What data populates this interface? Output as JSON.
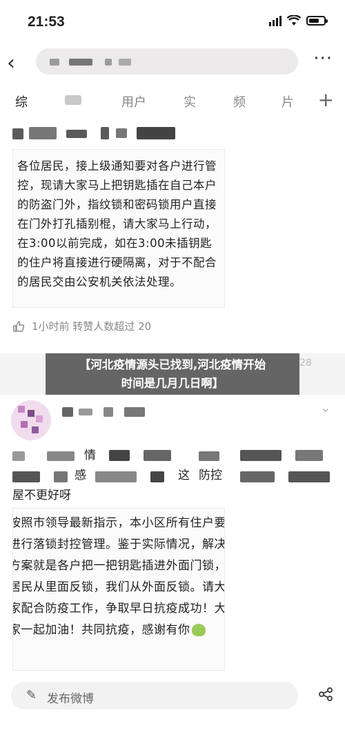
{
  "status": {
    "time": "21:53"
  },
  "nav": {
    "back_icon": "‹",
    "more_icon": "···"
  },
  "tabs": {
    "items": [
      "综",
      "用户",
      "实",
      "频",
      "片"
    ],
    "plus": "+"
  },
  "post1": {
    "notice_text": "各位居民，接上级通知要对各户进行管控，现请大家马上把钥匙插在自己本户的防盗门外，指纹锁和密码锁用户直接在门外打孔插别棍，请大家马上行动，在3:00以前完成，如在3:00未插钥匙的住户将直接进行硬隔离，对于不配合的居民交由公安机关依法处理。",
    "meta": "1小时前  转赞人数超过 20"
  },
  "banner": {
    "line1": "【河北疫情源头已找到,河北疫情开始",
    "line2": "时间是几月几日啊】",
    "right": "28"
  },
  "post2": {
    "text_line1": "情",
    "text_line2a": "感",
    "text_line2b": "这",
    "text_line2c": "防控",
    "text_line3": "屋不更好呀",
    "notice_text": "按照市领导最新指示，本小区所有住户要进行落锁封控管理。鉴于实际情况，解决方案就是各户把一把钥匙插进外面门锁，居民从里面反锁，我们从外面反锁。请大家配合防疫工作，争取早日抗疫成功！大家一起加油！共同抗疫，感谢有你"
  },
  "compose": {
    "placeholder": "发布微博",
    "share_icon": "share-icon"
  },
  "colors": {
    "banner_bg": "#3c3c3c",
    "card_bg": "#ffffff",
    "page_bg": "#f4f4f4"
  }
}
